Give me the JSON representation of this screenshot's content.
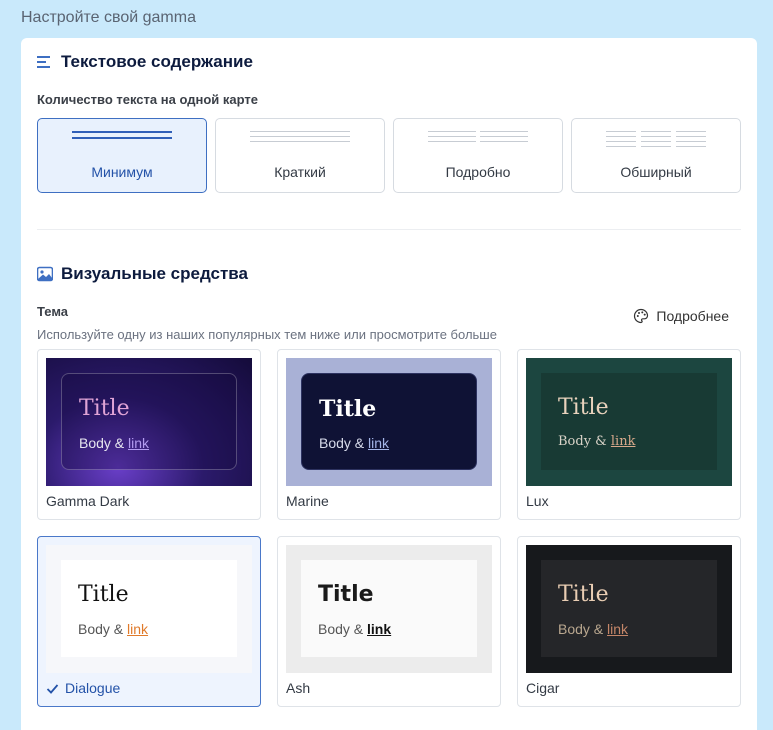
{
  "page_heading": "Настройте свой gamma",
  "text_section": {
    "title": "Текстовое содержание",
    "amount_label": "Количество текста на одной карте",
    "options": [
      {
        "label": "Минимум",
        "selected": true
      },
      {
        "label": "Краткий",
        "selected": false
      },
      {
        "label": "Подробно",
        "selected": false
      },
      {
        "label": "Обширный",
        "selected": false
      }
    ]
  },
  "visual_section": {
    "title": "Визуальные средства",
    "theme_label": "Тема",
    "theme_hint": "Используйте одну из наших популярных тем ниже или просмотрите больше",
    "more_label": "Подробнее",
    "themes": [
      {
        "name": "Gamma Dark",
        "title": "Title",
        "body": "Body &",
        "link": "link",
        "selected": false
      },
      {
        "name": "Marine",
        "title": "Title",
        "body": "Body &",
        "link": "link",
        "selected": false
      },
      {
        "name": "Lux",
        "title": "Title",
        "body": "Body &",
        "link": "link",
        "selected": false
      },
      {
        "name": "Dialogue",
        "title": "Title",
        "body": "Body &",
        "link": "link",
        "selected": true
      },
      {
        "name": "Ash",
        "title": "Title",
        "body": "Body &",
        "link": "link",
        "selected": false
      },
      {
        "name": "Cigar",
        "title": "Title",
        "body": "Body &",
        "link": "link",
        "selected": false
      }
    ]
  },
  "colors": {
    "accent": "#2352a8",
    "background": "#c9e9fb"
  }
}
